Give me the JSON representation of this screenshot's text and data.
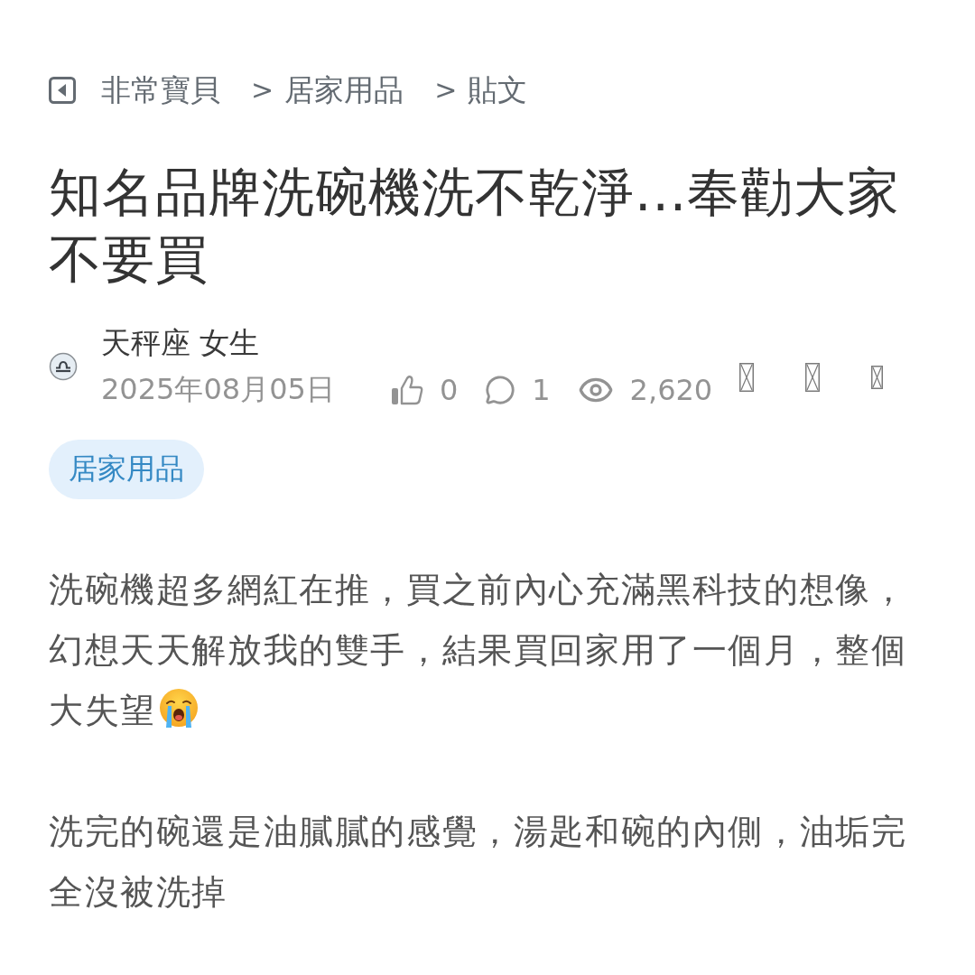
{
  "breadcrumb": [
    {
      "label": "非常寶貝"
    },
    {
      "separator": ">",
      "label": "居家用品"
    },
    {
      "separator": ">",
      "label": "貼文"
    }
  ],
  "title": "知名品牌洗碗機洗不乾淨...奉勸大家不要買",
  "author": {
    "name": "天秤座 女生",
    "date": "2025年08月05日"
  },
  "stats": [
    {
      "kind": "likes",
      "count": "0"
    },
    {
      "kind": "comments",
      "count": "1"
    },
    {
      "kind": "views",
      "count": "2,620"
    }
  ],
  "tags": [
    {
      "label": "居家用品"
    }
  ],
  "body": [
    {
      "text": "洗碗機超多網紅在推，買之前內心充滿黑科技的想像，幻想天天解放我的雙手，結果買回家用了一個月，整個大失望",
      "trailing_emoji": true
    },
    {
      "text": "洗完的碗還是油膩膩的感覺，湯匙和碗的內側，油垢完全沒被洗掉",
      "trailing_emoji": false
    }
  ]
}
